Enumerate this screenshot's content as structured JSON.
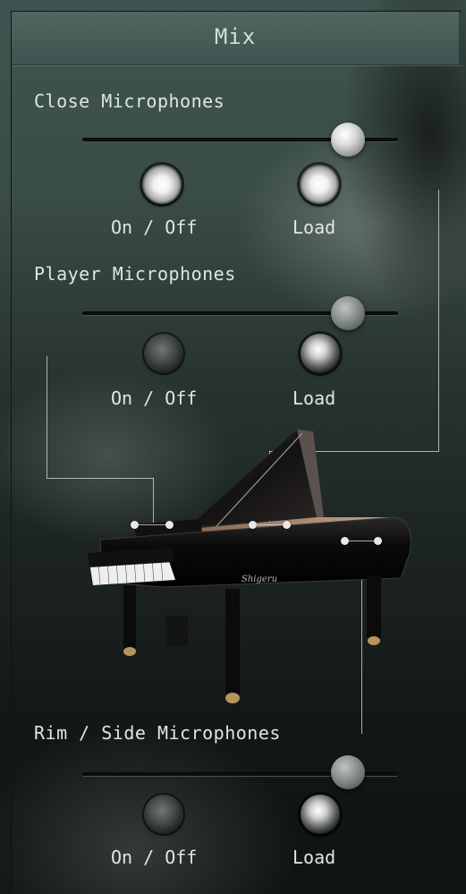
{
  "panel": {
    "title": "Mix"
  },
  "close": {
    "label": "Close Microphones",
    "level": 0.9,
    "on_off_label": "On / Off",
    "load_label": "Load",
    "on": true,
    "loaded": true
  },
  "player": {
    "label": "Player Microphones",
    "level": 0.9,
    "on_off_label": "On / Off",
    "load_label": "Load",
    "on": false,
    "loaded": false
  },
  "rim": {
    "label": "Rim / Side Microphones",
    "level": 0.9,
    "on_off_label": "On / Off",
    "load_label": "Load",
    "on": false,
    "loaded": false
  },
  "icons": {
    "piano": "grand-piano-image",
    "on_knob": "power-knob-icon",
    "load_knob": "load-knob-icon"
  },
  "colors": {
    "panel_bg": "#3a4c48",
    "text": "#dfe6e4",
    "line": "#dcdedd"
  }
}
